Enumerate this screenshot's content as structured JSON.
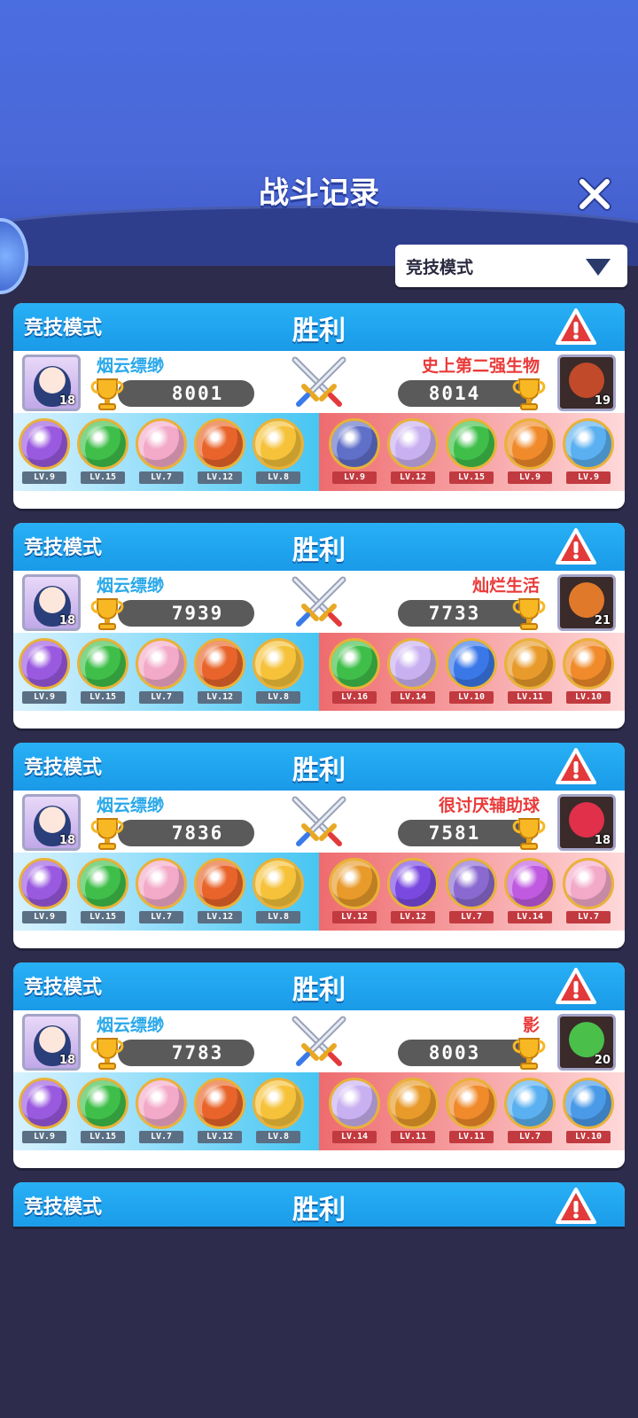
{
  "title": "战斗记录",
  "filter": {
    "selected": "竞技模式"
  },
  "records": [
    {
      "mode": "竞技模式",
      "result": "胜利",
      "me": {
        "name": "烟云缥缈",
        "level": "18",
        "trophies": "8001"
      },
      "opponent": {
        "name": "史上第二强生物",
        "level": "19",
        "trophies": "8014",
        "color": "#c14a2a"
      },
      "my_balls": [
        "LV.9",
        "LV.15",
        "LV.7",
        "LV.12",
        "LV.8"
      ],
      "opp_balls": [
        "LV.9",
        "LV.12",
        "LV.15",
        "LV.9",
        "LV.9"
      ],
      "my_colors": [
        "#9a5ae0",
        "#3fbf4a",
        "#f3a9c8",
        "#e8642a",
        "#f5c23a"
      ],
      "opp_colors": [
        "#6070c8",
        "#c9b0f0",
        "#3fbf4a",
        "#f08a2a",
        "#5ab0f0"
      ]
    },
    {
      "mode": "竞技模式",
      "result": "胜利",
      "me": {
        "name": "烟云缥缈",
        "level": "18",
        "trophies": "7939"
      },
      "opponent": {
        "name": "灿烂生活",
        "level": "21",
        "trophies": "7733",
        "color": "#e07a2a"
      },
      "my_balls": [
        "LV.9",
        "LV.15",
        "LV.7",
        "LV.12",
        "LV.8"
      ],
      "opp_balls": [
        "LV.16",
        "LV.14",
        "LV.10",
        "LV.11",
        "LV.10"
      ],
      "my_colors": [
        "#9a5ae0",
        "#3fbf4a",
        "#f3a9c8",
        "#e8642a",
        "#f5c23a"
      ],
      "opp_colors": [
        "#3fbf4a",
        "#c9b0f0",
        "#3a78e8",
        "#e89a2a",
        "#f08a2a"
      ]
    },
    {
      "mode": "竞技模式",
      "result": "胜利",
      "me": {
        "name": "烟云缥缈",
        "level": "18",
        "trophies": "7836"
      },
      "opponent": {
        "name": "很讨厌辅助球",
        "level": "18",
        "trophies": "7581",
        "color": "#e0304a"
      },
      "my_balls": [
        "LV.9",
        "LV.15",
        "LV.7",
        "LV.12",
        "LV.8"
      ],
      "opp_balls": [
        "LV.12",
        "LV.12",
        "LV.7",
        "LV.14",
        "LV.7"
      ],
      "my_colors": [
        "#9a5ae0",
        "#3fbf4a",
        "#f3a9c8",
        "#e8642a",
        "#f5c23a"
      ],
      "opp_colors": [
        "#e89a2a",
        "#7a4ae0",
        "#8a6ad0",
        "#c05ae0",
        "#f3a9c8"
      ]
    },
    {
      "mode": "竞技模式",
      "result": "胜利",
      "me": {
        "name": "烟云缥缈",
        "level": "18",
        "trophies": "7783"
      },
      "opponent": {
        "name": "影",
        "level": "20",
        "trophies": "8003",
        "color": "#4ac04a"
      },
      "my_balls": [
        "LV.9",
        "LV.15",
        "LV.7",
        "LV.12",
        "LV.8"
      ],
      "opp_balls": [
        "LV.14",
        "LV.11",
        "LV.11",
        "LV.7",
        "LV.10"
      ],
      "my_colors": [
        "#9a5ae0",
        "#3fbf4a",
        "#f3a9c8",
        "#e8642a",
        "#f5c23a"
      ],
      "opp_colors": [
        "#c9b0f0",
        "#e89a2a",
        "#f08a2a",
        "#5ab0f0",
        "#4a9ae8"
      ]
    },
    {
      "mode": "竞技模式",
      "result": "胜利"
    }
  ]
}
